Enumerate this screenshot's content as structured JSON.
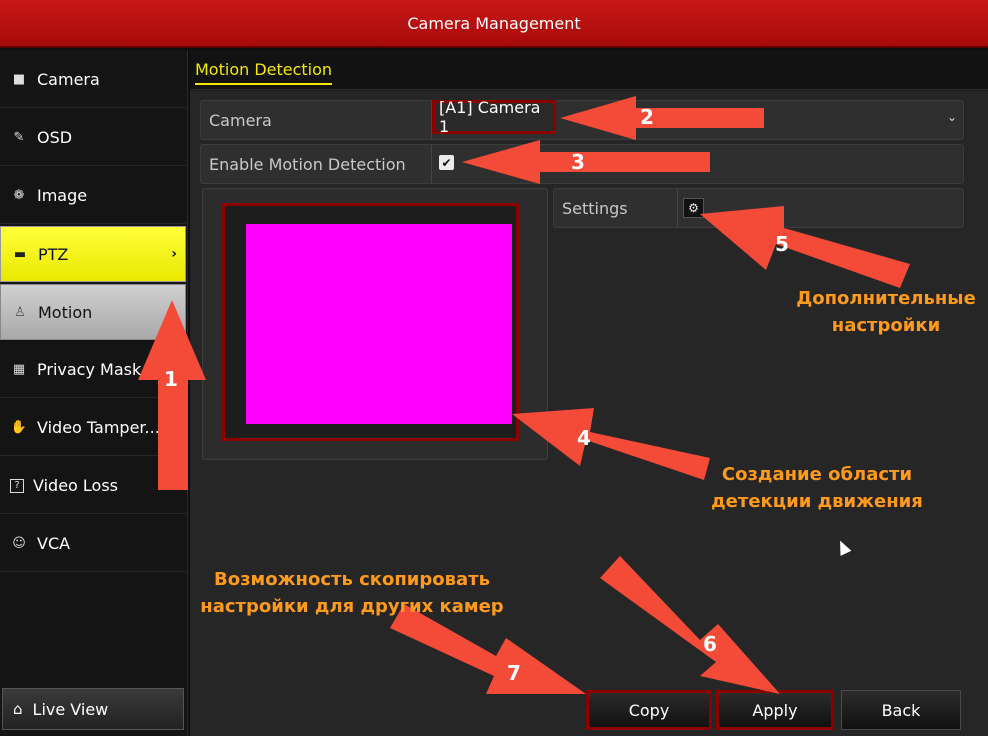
{
  "window": {
    "title": "Camera Management"
  },
  "sidebar": {
    "items": [
      {
        "label": "Camera",
        "icon": "camera-icon"
      },
      {
        "label": "OSD",
        "icon": "pen-icon"
      },
      {
        "label": "Image",
        "icon": "image-icon"
      },
      {
        "label": "PTZ",
        "icon": "ptz-icon"
      },
      {
        "label": "Motion",
        "icon": "motion-icon"
      },
      {
        "label": "Privacy Mask",
        "icon": "mask-icon"
      },
      {
        "label": "Video Tamper...",
        "icon": "hand-icon"
      },
      {
        "label": "Video Loss",
        "icon": "question-icon"
      },
      {
        "label": "VCA",
        "icon": "vca-icon"
      }
    ],
    "live_view_label": "Live View"
  },
  "main": {
    "tab_label": "Motion Detection",
    "camera_label": "Camera",
    "camera_value": "[A1] Camera 1",
    "enable_label": "Enable Motion Detection",
    "enable_checked": true,
    "settings_label": "Settings"
  },
  "buttons": {
    "copy": "Copy",
    "apply": "Apply",
    "back": "Back"
  },
  "annotations": {
    "n1": "1",
    "n2": "2",
    "n3": "3",
    "n4": "4",
    "n5": "5",
    "n6": "6",
    "n7": "7",
    "extra_settings_line1": "Дополнительные",
    "extra_settings_line2": "настройки",
    "area_line1": "Создание области",
    "area_line2": "детекции движения",
    "copy_line1": "Возможность скопировать",
    "copy_line2": "настройки для других камер"
  },
  "colors": {
    "accent_red": "#b00f0f",
    "tab_yellow": "#f4e800",
    "arrow_red": "#f44a38",
    "annotation_orange": "#ff9a1c",
    "motion_area": "#ff00ff"
  }
}
